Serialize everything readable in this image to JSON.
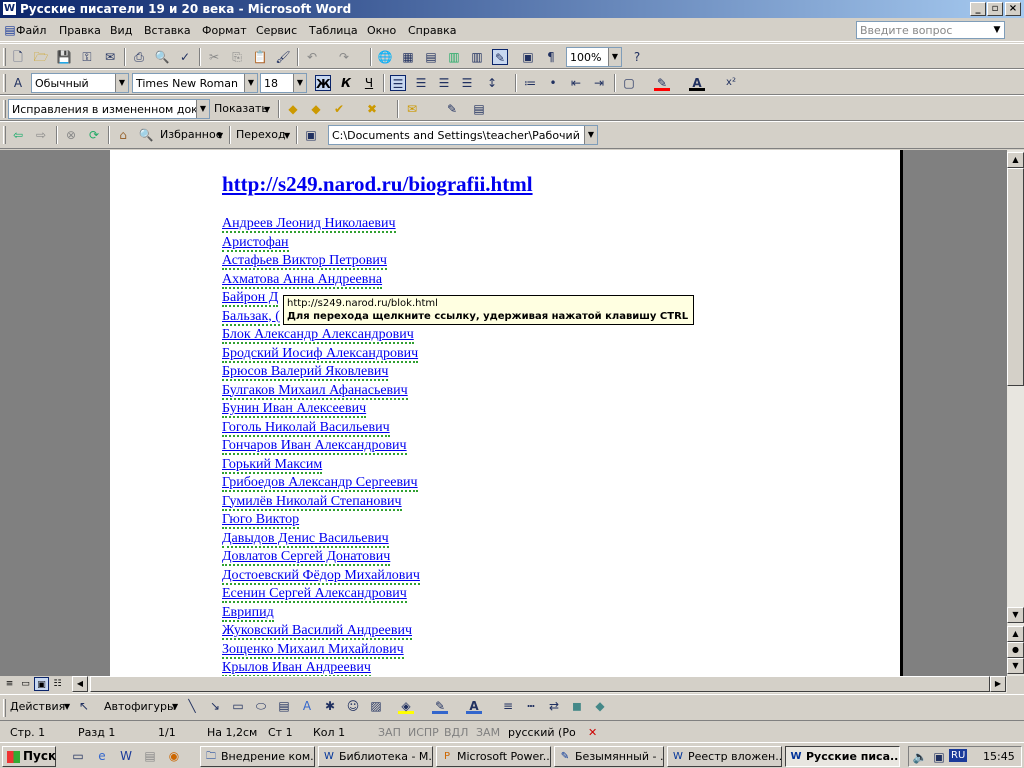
{
  "window": {
    "title": "Русские писатели 19 и 20 века - Microsoft Word"
  },
  "menu": [
    "Файл",
    "Правка",
    "Вид",
    "Вставка",
    "Формат",
    "Сервис",
    "Таблица",
    "Окно",
    "Справка"
  ],
  "ask": {
    "placeholder": "Введите вопрос"
  },
  "standard_toolbar": {
    "zoom": "100%"
  },
  "format_toolbar": {
    "style": "Обычный",
    "font": "Times New Roman",
    "size": "18",
    "bold": "Ж",
    "italic": "К",
    "underline": "Ч"
  },
  "review_toolbar": {
    "display": "Исправления в измененном документе",
    "show": "Показать"
  },
  "web_toolbar": {
    "favorites": "Избранное",
    "goto": "Переход",
    "address": "C:\\Documents and Settings\\teacher\\Рабочий стол\\Биогр"
  },
  "document": {
    "heading": "http://s249.narod.ru/biografii.html",
    "links": [
      "Андреев Леонид Николаевич",
      "Аристофан",
      "Астафьев Виктор Петрович",
      "Ахматова Анна Андреевна",
      "Байрон Д",
      "Бальзак, (",
      "Блок Александр Александрович",
      "Бродский Иосиф Александрович",
      "Брюсов Валерий Яковлевич",
      "Булгаков Михаил Афанасьевич",
      "Бунин Иван Алексеевич",
      "Гоголь Николай Васильевич",
      "Гончаров Иван Александрович",
      "Горький Максим",
      "Грибоедов Александр Сергеевич",
      "Гумилёв Николай Степанович",
      "Гюго Виктор",
      "Давыдов Денис Васильевич",
      "Довлатов Сергей Донатович",
      "Достоевский Фёдор Михайлович",
      "Есенин Сергей Александрович",
      "Еврипид",
      "Жуковский Василий Андреевич",
      "Зощенко Михаил Михайлович",
      "Крылов Иван Андреевич"
    ]
  },
  "tooltip": {
    "url": "http://s249.narod.ru/blok.html",
    "hint": "Для перехода щелкните ссылку, удерживая нажатой клавишу CTRL"
  },
  "drawing_toolbar": {
    "actions": "Действия",
    "autoshapes": "Автофигуры"
  },
  "statusbar": {
    "page": "Стр. 1",
    "section": "Разд 1",
    "pages": "1/1",
    "at": "На 1,2см",
    "line": "Ст 1",
    "col": "Кол 1",
    "rec": "ЗАП",
    "trk": "ИСПР",
    "ext": "ВДЛ",
    "ovr": "ЗАМ",
    "lang": "русский (Ро"
  },
  "taskbar": {
    "start": "Пуск",
    "tasks": [
      "Внедрение ком...",
      "Библиотека - М...",
      "Microsoft Power...",
      "Безымянный - ...",
      "Реестр вложен...",
      "Русские писа..."
    ],
    "lang": "RU",
    "clock": "15:45"
  }
}
